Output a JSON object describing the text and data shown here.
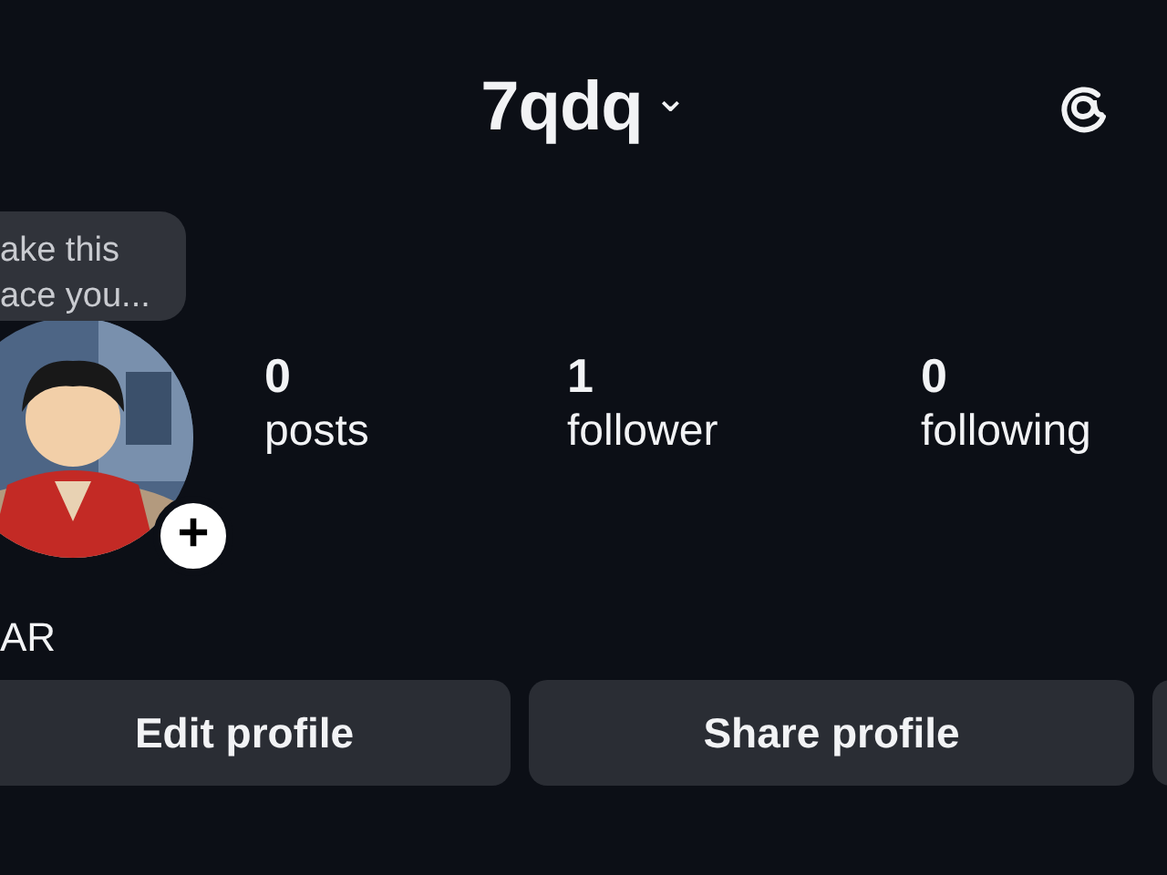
{
  "header": {
    "username": "7qdq",
    "switch_caret": "⌄"
  },
  "tooltip": {
    "lines": [
      "ake this",
      "ace you..."
    ]
  },
  "avatar": {
    "kind": "picture",
    "add_badge": "+"
  },
  "display_name": "AR",
  "stats": [
    {
      "value": "0",
      "label": "posts"
    },
    {
      "value": "1",
      "label": "follower"
    },
    {
      "value": "0",
      "label": "following"
    }
  ],
  "buttons": [
    {
      "label": "Edit profile"
    },
    {
      "label": "Share profile"
    }
  ],
  "partial_button": true
}
